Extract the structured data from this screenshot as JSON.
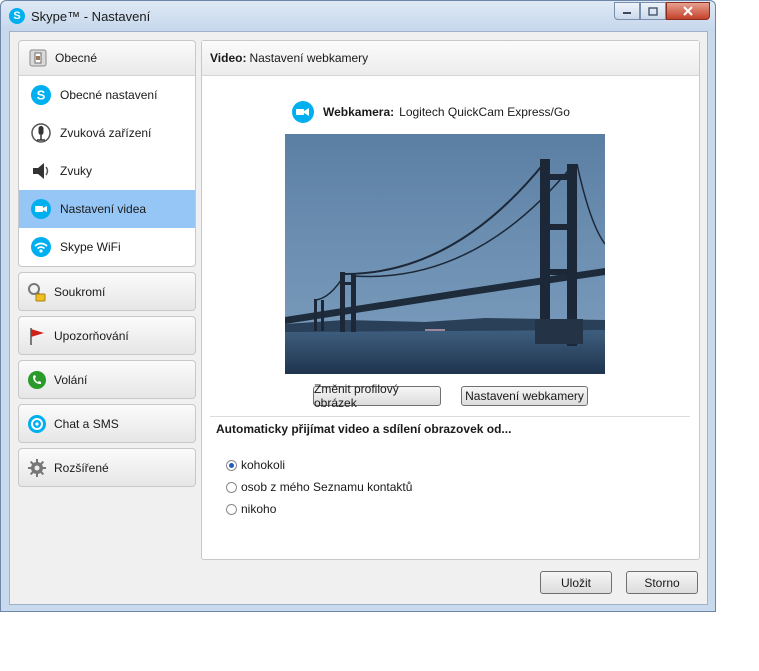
{
  "window": {
    "title": "Skype™ - Nastavení"
  },
  "sidebar": {
    "general": {
      "label": "Obecné",
      "items": [
        {
          "label": "Obecné nastavení",
          "icon": "skype-icon"
        },
        {
          "label": "Zvuková zařízení",
          "icon": "microphone-icon"
        },
        {
          "label": "Zvuky",
          "icon": "speaker-icon"
        },
        {
          "label": "Nastavení videa",
          "icon": "video-icon",
          "selected": true
        },
        {
          "label": "Skype WiFi",
          "icon": "wifi-icon"
        }
      ]
    },
    "groups": [
      {
        "label": "Soukromí",
        "icon": "lock-icon"
      },
      {
        "label": "Upozorňování",
        "icon": "flag-icon"
      },
      {
        "label": "Volání",
        "icon": "phone-icon"
      },
      {
        "label": "Chat a SMS",
        "icon": "chat-icon"
      },
      {
        "label": "Rozšířené",
        "icon": "gear-icon"
      }
    ]
  },
  "panel": {
    "header_bold": "Video:",
    "header_text": "Nastavení webkamery",
    "webcam_label": "Webkamera:",
    "webcam_value": "Logitech QuickCam Express/Go",
    "change_picture_button": "Změnit profilový obrázek",
    "webcam_settings_button": "Nastavení webkamery",
    "auto_accept_label": "Automaticky přijímat video a sdílení obrazovek od...",
    "options": [
      {
        "label": "kohokoli",
        "checked": true
      },
      {
        "label": "osob z mého Seznamu kontaktů",
        "checked": false
      },
      {
        "label": "nikoho",
        "checked": false
      }
    ]
  },
  "footer": {
    "save_button": "Uložit",
    "cancel_button": "Storno"
  },
  "colors": {
    "accent": "#00aff0",
    "selected_item": "#96c6f5"
  }
}
